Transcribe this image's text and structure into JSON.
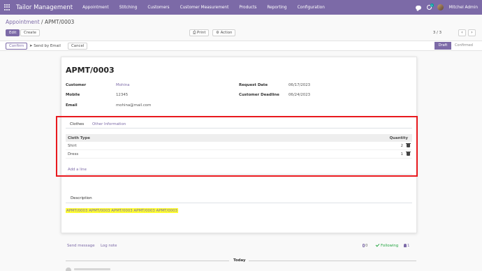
{
  "navbar": {
    "brand": "Tailor Management",
    "menu": [
      "Appointment",
      "Stitching",
      "Customers",
      "Customer Measurement",
      "Products",
      "Reporting",
      "Configuration"
    ],
    "notification_count": "1",
    "user_name": "Mitchel Admin",
    "icons": [
      "apps-grid-icon",
      "chat-icon",
      "activity-clock-icon",
      "avatar"
    ]
  },
  "breadcrumb": {
    "parent": "Appointment",
    "separator": " / ",
    "current": "APMT/0003"
  },
  "toolbar": {
    "edit": "Edit",
    "create": "Create",
    "print": "Print",
    "action": "Action",
    "pager": "3 / 3",
    "prev": "‹",
    "next": "›"
  },
  "statusbar": {
    "confirm": "Confirm",
    "send_email": "Send by Email",
    "cancel": "Cancel",
    "stage_new": "Draft",
    "stage_done": "Confirmed"
  },
  "record": {
    "name": "APMT/0003",
    "fields": {
      "customer_label": "Customer",
      "customer_value": "Mohina",
      "mobile_label": "Mobile",
      "mobile_value": "12345",
      "email_label": "Email",
      "email_value": "mohina@mail.com",
      "request_date_label": "Request Date",
      "request_date_value": "06/17/2023",
      "deadline_label": "Customer Deadline",
      "deadline_value": "06/24/2023"
    },
    "tabs": [
      "Clothes",
      "Other Information"
    ],
    "table": {
      "headers": [
        "Cloth Type",
        "Quantity"
      ],
      "rows": [
        {
          "cloth": "Shirt",
          "qty": "2"
        },
        {
          "cloth": "Dress",
          "qty": "1"
        }
      ],
      "add_line": "Add a line"
    },
    "description_tab": "Description",
    "description_text": "APMT/0003 APMT/0003 APMT/0003 APMT/0003 APMT/0003"
  },
  "chatter": {
    "send_message": "Send message",
    "log_note": "Log note",
    "attachments": "0",
    "following": "Following",
    "followers": "1",
    "today": "Today"
  },
  "colors": {
    "brand": "#7c6aa7",
    "highlight": "#e8191e",
    "text_highlight": "#ffff33",
    "following": "#28a745"
  }
}
